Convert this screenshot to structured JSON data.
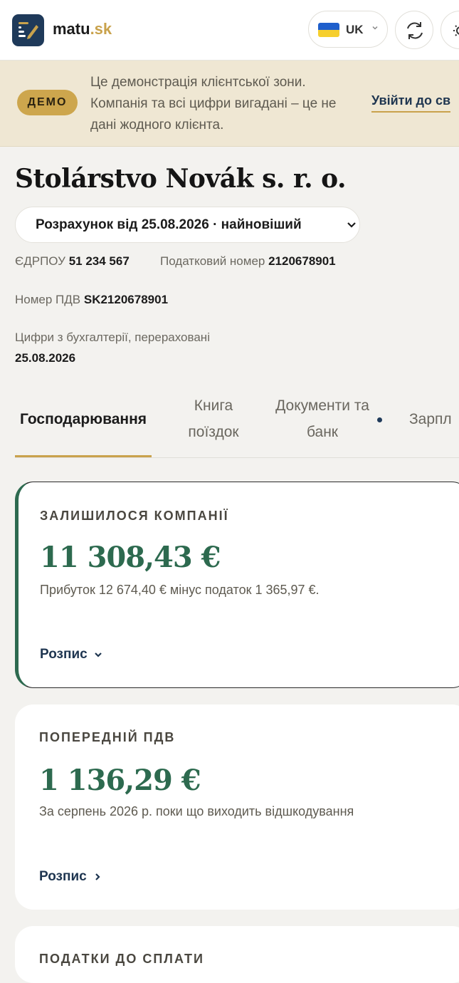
{
  "header": {
    "logo_main": "matu",
    "logo_tld": ".sk",
    "language_code": "UK",
    "icons": [
      "logo-icon",
      "flag-ua-icon",
      "refresh-icon",
      "theme-sun-icon"
    ]
  },
  "banner": {
    "badge": "ДЕМО",
    "text": "Це демонстрація клієнтської зони. Компанія та всі цифри вигадані – це не дані жодного клієнта.",
    "link": "Увійти до св"
  },
  "company": {
    "name": "Stolárstvo Novák s. r. o.",
    "calculation_select": "Розрахунок від 25.08.2026 · найновіший",
    "edrpou_label": "ЄДРПОУ",
    "edrpou_value": "51 234 567",
    "tax_label": "Податковий номер",
    "tax_value": "2120678901",
    "vat_label": "Номер ПДВ",
    "vat_value": "SK2120678901",
    "recalc_text": "Цифри з бухгалтерії, перераховані",
    "recalc_date": "25.08.2026"
  },
  "tabs": [
    {
      "label": "Господарювання",
      "active": true
    },
    {
      "label": "Книга поїздок",
      "active": false
    },
    {
      "label": "Документи та банк",
      "active": false,
      "has_dot": true
    },
    {
      "label": "Зарпл",
      "active": false
    }
  ],
  "cards": [
    {
      "label": "ЗАЛИШИЛОСЯ КОМПАНІЇ",
      "amount": "11 308,43 €",
      "desc": "Прибуток 12 674,40 € мінус податок 1 365,97 €.",
      "breakdown": "Розпис",
      "chevron": "chevron-down-icon"
    },
    {
      "label": "ПОПЕРЕДНІЙ ПДВ",
      "amount": "1 136,29 €",
      "desc": "За серпень 2026 р. поки що виходить відшкодування",
      "breakdown": "Розпис",
      "chevron": "chevron-right-icon"
    },
    {
      "label": "ПОДАТКИ ДО СПЛАТИ"
    }
  ],
  "colors": {
    "brand_navy": "#1f3a5a",
    "gold": "#c9a24c",
    "amount_green": "#2d6a4f",
    "banner_bg": "#efe7d3",
    "page_bg": "#f3f2ef"
  }
}
